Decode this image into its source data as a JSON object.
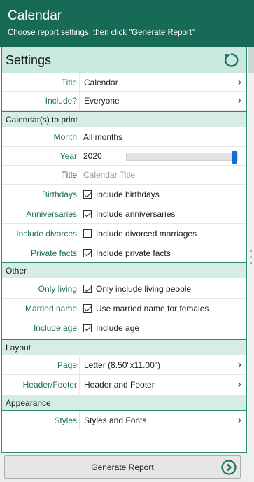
{
  "header": {
    "title": "Calendar",
    "subtitle": "Choose report settings, then click \"Generate Report\""
  },
  "settings": {
    "label": "Settings",
    "reset_icon": "reset-icon"
  },
  "rows_top": [
    {
      "label": "Title",
      "value": "Calendar",
      "chevron": true
    },
    {
      "label": "Include?",
      "value": "Everyone",
      "chevron": true
    }
  ],
  "sections": {
    "calendars": "Calendar(s) to print",
    "other": "Other",
    "layout": "Layout",
    "appearance": "Appearance"
  },
  "calendar_rows": {
    "month": {
      "label": "Month",
      "value": "All months"
    },
    "year": {
      "label": "Year",
      "value": "2020",
      "slider_fraction": 1.0
    },
    "title": {
      "label": "Title",
      "placeholder": "Calendar Title"
    },
    "birthdays": {
      "label": "Birthdays",
      "text": "Include birthdays",
      "checked": true
    },
    "anniversaries": {
      "label": "Anniversaries",
      "text": "Include anniversaries",
      "checked": true
    },
    "divorces": {
      "label": "Include divorces",
      "text": "Include divorced marriages",
      "checked": false
    },
    "private": {
      "label": "Private facts",
      "text": "Include private facts",
      "checked": true
    }
  },
  "other_rows": {
    "living": {
      "label": "Only living",
      "text": "Only include living people",
      "checked": true
    },
    "married": {
      "label": "Married name",
      "text": "Use married name for females",
      "checked": true
    },
    "age": {
      "label": "Include age",
      "text": "Include age",
      "checked": true
    }
  },
  "layout_rows": {
    "page": {
      "label": "Page",
      "value": "Letter (8.50\"x11.00\")"
    },
    "header_footer": {
      "label": "Header/Footer",
      "value": "Header and Footer"
    }
  },
  "appearance_rows": {
    "styles": {
      "label": "Styles",
      "value": "Styles and Fonts"
    }
  },
  "footer": {
    "button_label": "Generate Report"
  },
  "colors": {
    "header": "#166a56",
    "accent": "#2a8a6e",
    "label": "#1f6e5b",
    "section_bg": "#d6ede6",
    "slider_thumb": "#0f6fd6"
  }
}
